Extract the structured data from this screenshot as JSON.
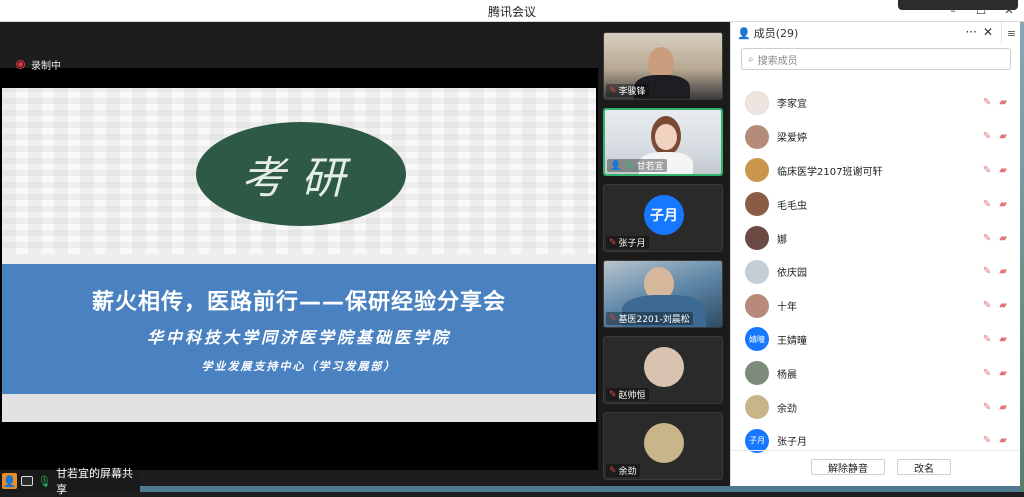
{
  "window": {
    "title": "腾讯会议"
  },
  "recording": {
    "label": "录制中"
  },
  "slide": {
    "emblem_text": "考研",
    "headline": "薪火相传，医路前行——保研经验分享会",
    "subtitle": "华中科技大学同济医学院基础医学院",
    "org": "学业发展支持中心（学习发展部）"
  },
  "share_bar": {
    "text": "甘若宜的屏幕共享"
  },
  "gallery": [
    {
      "name": "李骏锋",
      "mic": "off",
      "kind": "camera",
      "bg": "cam-bg1"
    },
    {
      "name": "甘若宜",
      "mic": "on",
      "kind": "camera",
      "bg": "cam-bg2",
      "active": true
    },
    {
      "name": "张子月",
      "mic": "off",
      "kind": "avatar",
      "avatar_text": "子月",
      "color": "#1677ff"
    },
    {
      "name": "基医2201-刘晨松",
      "mic": "off",
      "kind": "camera",
      "bg": "cam-bg3"
    },
    {
      "name": "赵帅恒",
      "mic": "off",
      "kind": "avatar",
      "avatar_text": "",
      "color": "#d9c4b1"
    },
    {
      "name": "余劲",
      "mic": "off",
      "kind": "avatar",
      "avatar_text": "",
      "color": "#c9b58a"
    }
  ],
  "members_panel": {
    "title": "成员(29)",
    "search_placeholder": "搜索成员",
    "members": [
      {
        "name": "李家宜",
        "avatar_text": "",
        "color": "#efe4e0"
      },
      {
        "name": "梁爱婷",
        "avatar_text": "",
        "color": "#b48c79"
      },
      {
        "name": "临床医学2107班谢可轩",
        "avatar_text": "",
        "color": "#c9964b"
      },
      {
        "name": "毛毛虫",
        "avatar_text": "",
        "color": "#8c5b46"
      },
      {
        "name": "娜",
        "avatar_text": "",
        "color": "#6a4a42"
      },
      {
        "name": "依庆园",
        "avatar_text": "",
        "color": "#c7cdd6"
      },
      {
        "name": "十年",
        "avatar_text": "",
        "color": "#b88a7c"
      },
      {
        "name": "王婧曈",
        "avatar_text": "婧曈",
        "color": "#1677ff"
      },
      {
        "name": "杨晨",
        "avatar_text": "",
        "color": "#7d8c7a"
      },
      {
        "name": "余劲",
        "avatar_text": "",
        "color": "#c9b58a"
      },
      {
        "name": "张子月",
        "avatar_text": "子月",
        "color": "#1677ff"
      }
    ],
    "unmute_label": "解除静音",
    "rename_label": "改名"
  }
}
